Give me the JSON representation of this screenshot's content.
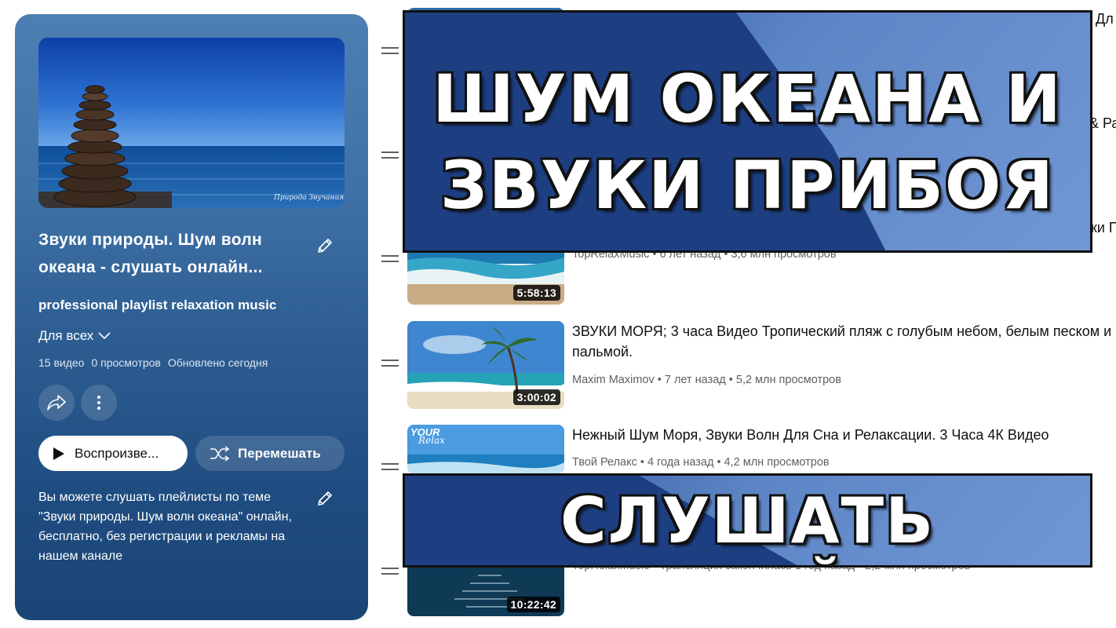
{
  "playlist": {
    "title_line1": "Звуки природы. Шум волн",
    "title_line2": "океана - слушать онлайн...",
    "author": "professional playlist relaxation music",
    "privacy": "Для всех",
    "stats": {
      "videos": "15 видео",
      "views": "0 просмотров",
      "updated": "Обновлено сегодня"
    },
    "play_label": "Воспроизве...",
    "shuffle_label": "Перемешать",
    "description": "Вы можете слушать плейлисты по теме \"Звуки природы. Шум волн океана\" онлайн, бесплатно, без регистрации и рекламы на нашем канале",
    "cover_watermark": "Природа Звучания"
  },
  "videos": [
    {
      "peek_title": "Дл"
    },
    {
      "peek_title": "& Ра"
    },
    {
      "peek_title": "ки П",
      "meta": "TopRelaxMusic • 6 лет назад • 3,6 млн просмотров",
      "duration": "5:58:13"
    },
    {
      "title": "ЗВУКИ МОРЯ; 3 часа Видео Тропический пляж с голубым небом, белым песком и пальмой.",
      "meta": "Maxim Maximov • 7 лет назад • 5,2 млн просмотров",
      "duration": "3:00:02"
    },
    {
      "title": "Нежный Шум Моря, Звуки Волн Для Сна и Релаксации. 3 Часа 4К Видео",
      "meta": "Твой Релакс • 4 года назад • 4,2 млн просмотров",
      "thumb_text_1": "YOUR",
      "thumb_text_2": "Relax"
    },
    {
      "meta": "TopRelaxMusic • Трансляция закончилась 1 год назад • 2,2 млн просмотров",
      "duration": "10:22:42"
    }
  ],
  "banners": {
    "top_line1": "ШУМ ОКЕАНА И",
    "top_line2": "ЗВУКИ ПРИБОЯ",
    "bottom": "СЛУШАТЬ ОНЛАЙН"
  },
  "colors": {
    "panel": "#2c5c90",
    "banner_dark": "#1d3f82",
    "banner_light": "#7196d4"
  }
}
